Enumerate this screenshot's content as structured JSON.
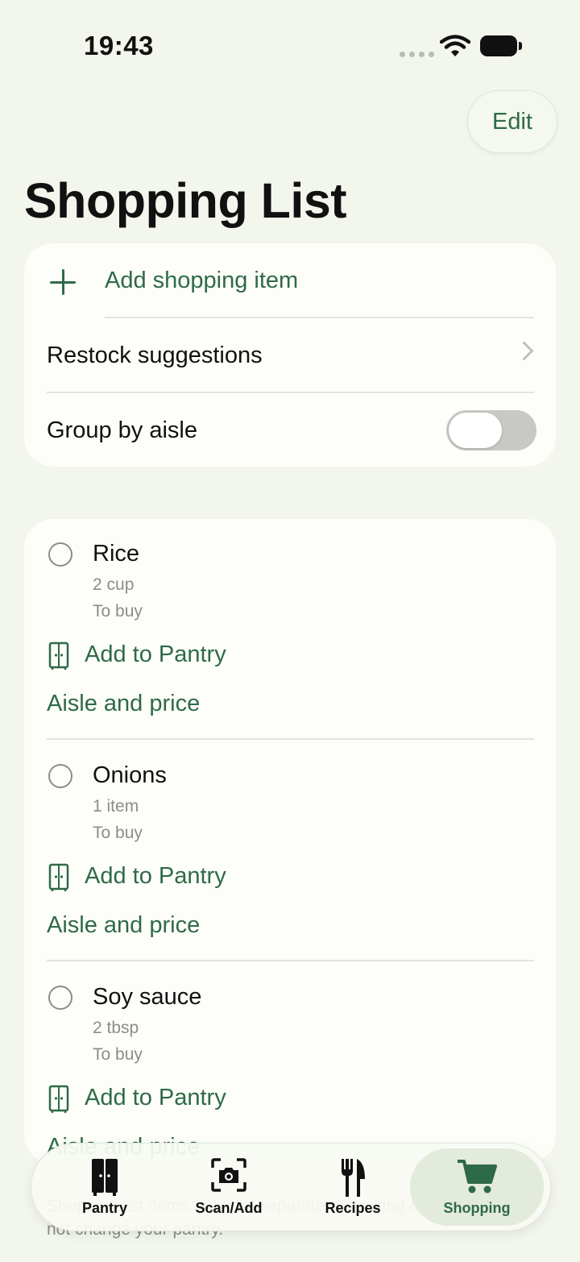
{
  "status_bar": {
    "time": "19:43"
  },
  "header": {
    "edit_label": "Edit",
    "title": "Shopping List"
  },
  "controls": {
    "add_item_label": "Add shopping item",
    "restock_label": "Restock suggestions",
    "group_by_aisle_label": "Group by aisle",
    "group_by_aisle_on": false
  },
  "items": [
    {
      "name": "Rice",
      "quantity": "2 cup",
      "status": "To buy",
      "add_to_pantry": "Add to Pantry",
      "aisle_price": "Aisle and price"
    },
    {
      "name": "Onions",
      "quantity": "1 item",
      "status": "To buy",
      "add_to_pantry": "Add to Pantry",
      "aisle_price": "Aisle and price"
    },
    {
      "name": "Soy sauce",
      "quantity": "2 tbsp",
      "status": "To buy",
      "add_to_pantry": "Add to Pantry",
      "aisle_price": "Aisle and price"
    }
  ],
  "footer_note": "Shopping list items are kept separate. Checking off items does not change your pantry.",
  "tabs": [
    {
      "label": "Pantry",
      "icon": "pantry-cabinet-icon"
    },
    {
      "label": "Scan/Add",
      "icon": "camera-scan-icon"
    },
    {
      "label": "Recipes",
      "icon": "fork-knife-icon"
    },
    {
      "label": "Shopping",
      "icon": "shopping-cart-icon",
      "active": true
    }
  ],
  "colors": {
    "accent": "#2f6a48",
    "background": "#f2f6ec",
    "card": "#fdfef9"
  }
}
